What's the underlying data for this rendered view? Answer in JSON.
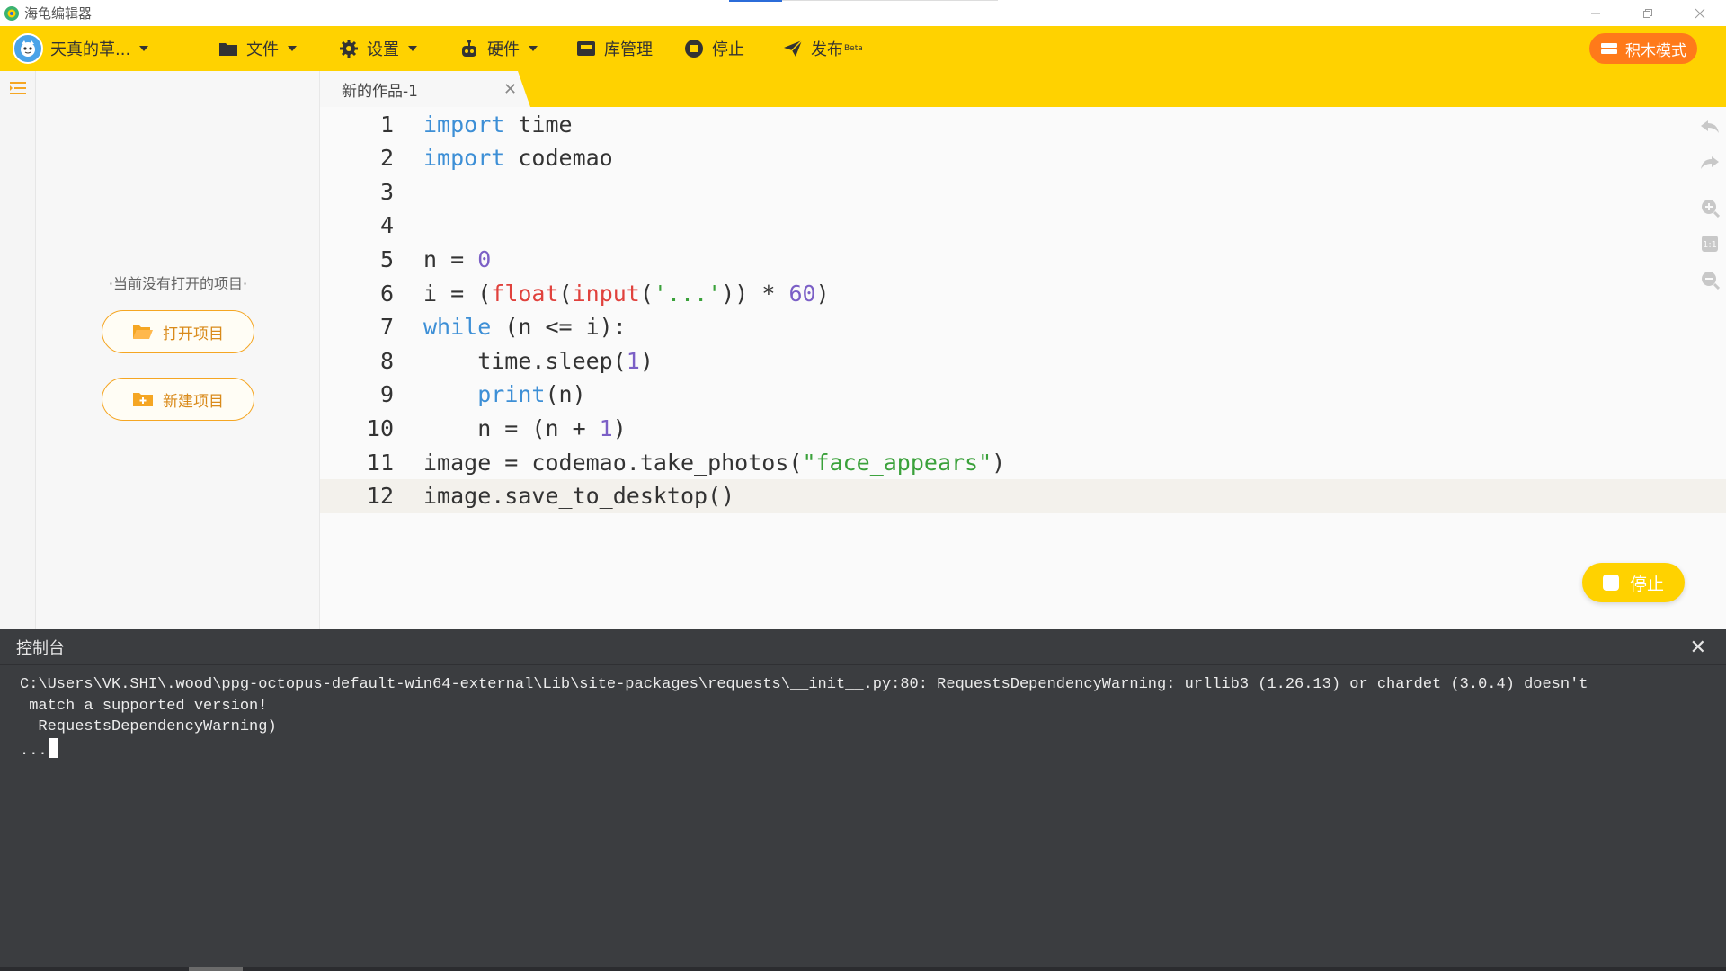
{
  "window": {
    "title": "海龟编辑器",
    "controls": [
      "minimize",
      "restore",
      "close"
    ]
  },
  "toolbar": {
    "user_name": "天真的草...",
    "items": [
      {
        "label": "文件",
        "icon": "folder-icon",
        "dropdown": true
      },
      {
        "label": "设置",
        "icon": "gear-icon",
        "dropdown": true
      },
      {
        "label": "硬件",
        "icon": "robot-icon",
        "dropdown": true
      },
      {
        "label": "库管理",
        "icon": "library-icon",
        "dropdown": false
      },
      {
        "label": "停止",
        "icon": "stop-icon",
        "dropdown": false
      },
      {
        "label": "发布",
        "icon": "send-icon",
        "dropdown": false,
        "superscript": "Beta"
      }
    ],
    "block_mode_label": "积木模式"
  },
  "project_panel": {
    "empty_text": "·当前没有打开的项目·",
    "open_label": "打开项目",
    "new_label": "新建项目"
  },
  "editor": {
    "tab_title": "新的作品-1",
    "active_line": 12,
    "lines": [
      {
        "n": "1"
      },
      {
        "n": "2"
      },
      {
        "n": "3"
      },
      {
        "n": "4"
      },
      {
        "n": "5"
      },
      {
        "n": "6"
      },
      {
        "n": "7"
      },
      {
        "n": "8"
      },
      {
        "n": "9"
      },
      {
        "n": "10"
      },
      {
        "n": "11"
      },
      {
        "n": "12"
      }
    ],
    "code": [
      [
        [
          "kw",
          "import"
        ],
        [
          "t",
          " time"
        ]
      ],
      [
        [
          "kw",
          "import"
        ],
        [
          "t",
          " codemao"
        ]
      ],
      [],
      [],
      [
        [
          "t",
          "n = "
        ],
        [
          "num",
          "0"
        ]
      ],
      [
        [
          "t",
          "i = ("
        ],
        [
          "fn",
          "float"
        ],
        [
          "t",
          "("
        ],
        [
          "fn",
          "input"
        ],
        [
          "t",
          "("
        ],
        [
          "str",
          "'...'"
        ],
        [
          "t",
          ")) * "
        ],
        [
          "num",
          "60"
        ],
        [
          "t",
          ")"
        ]
      ],
      [
        [
          "kw",
          "while"
        ],
        [
          "t",
          " (n <= i):"
        ]
      ],
      [
        [
          "t",
          "    time.sleep("
        ],
        [
          "num",
          "1"
        ],
        [
          "t",
          ")"
        ]
      ],
      [
        [
          "t",
          "    "
        ],
        [
          "kw",
          "print"
        ],
        [
          "t",
          "(n)"
        ]
      ],
      [
        [
          "t",
          "    n = (n + "
        ],
        [
          "num",
          "1"
        ],
        [
          "t",
          ")"
        ]
      ],
      [
        [
          "t",
          "image = codemao.take_photos("
        ],
        [
          "str",
          "\"face_appears\""
        ],
        [
          "t",
          ")"
        ]
      ],
      [
        [
          "t",
          "image.save_to_desktop()"
        ]
      ]
    ],
    "float_stop_label": "停止"
  },
  "console": {
    "title": "控制台",
    "lines": [
      "C:\\Users\\VK.SHI\\.wood\\ppg-octopus-default-win64-external\\Lib\\site-packages\\requests\\__init__.py:80: RequestsDependencyWarning: urllib3 (1.26.13) or chardet (3.0.4) doesn't",
      " match a supported version!",
      "  RequestsDependencyWarning)",
      "..."
    ]
  },
  "colors": {
    "toolbar": "#ffd200",
    "accent_orange": "#ff7a1a",
    "keyword": "#3d8fd6",
    "builtin": "#e0413c",
    "number": "#7b5fc6",
    "string": "#3aa13a",
    "console_bg": "#3b3d40"
  }
}
